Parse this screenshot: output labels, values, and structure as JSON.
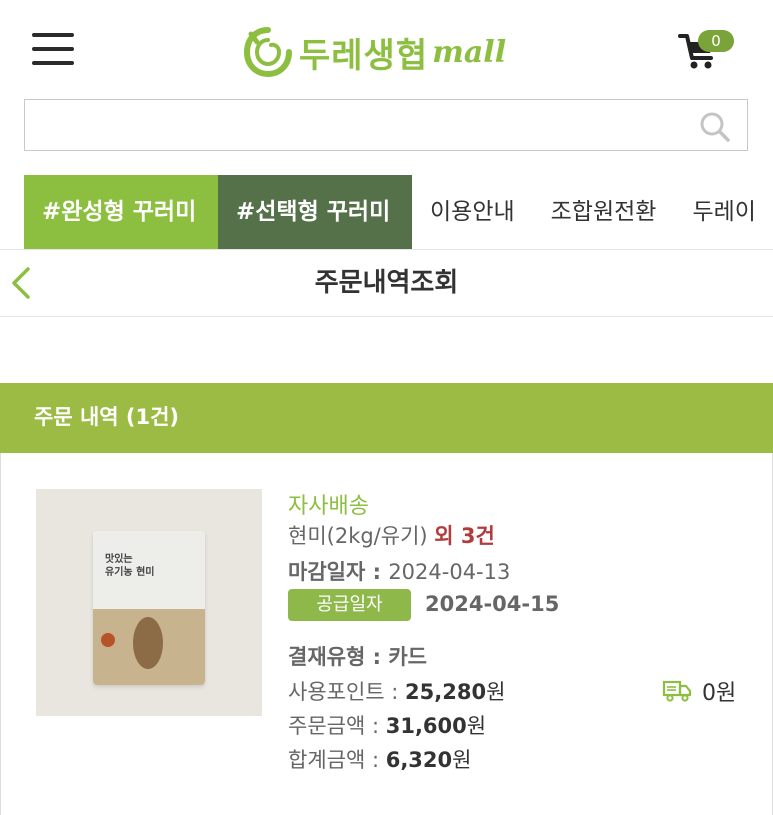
{
  "header": {
    "logo_text": "두레생협",
    "logo_mall": "mall",
    "cart_count": "0"
  },
  "search": {
    "placeholder": ""
  },
  "tabs": [
    {
      "label": "#완성형 꾸러미"
    },
    {
      "label": "#선택형 꾸러미"
    },
    {
      "label": "이용안내"
    },
    {
      "label": "조합원전환"
    },
    {
      "label": "두레이"
    }
  ],
  "page": {
    "title": "주문내역조회"
  },
  "order_section": {
    "title": "주문 내역 (1건)"
  },
  "order": {
    "delivery_type": "자사배송",
    "product_name": "현미(2kg/유기)",
    "more_items": "외 3건",
    "deadline_label": "마감일자 : ",
    "deadline_date": "2024-04-13",
    "supply_label": "공급일자",
    "supply_date": "2024-04-15",
    "pay_type_label": "결재유형 : ",
    "pay_type": "카드",
    "points_label": "사용포인트 : ",
    "points_value": "25,280",
    "order_amount_label": "주문금액 : ",
    "order_amount_value": "31,600",
    "total_label": "합계금액 : ",
    "total_value": "6,320",
    "currency": "원",
    "shipping_fee": "0원"
  },
  "product_image": {
    "bag_label_line1": "맛있는",
    "bag_label_line2": "유기농 현미"
  },
  "colors": {
    "brand_green": "#8cbf3f",
    "dark_green_tab": "#54714a",
    "section_bar": "#9bbb45",
    "accent_red": "#b23c3c"
  }
}
